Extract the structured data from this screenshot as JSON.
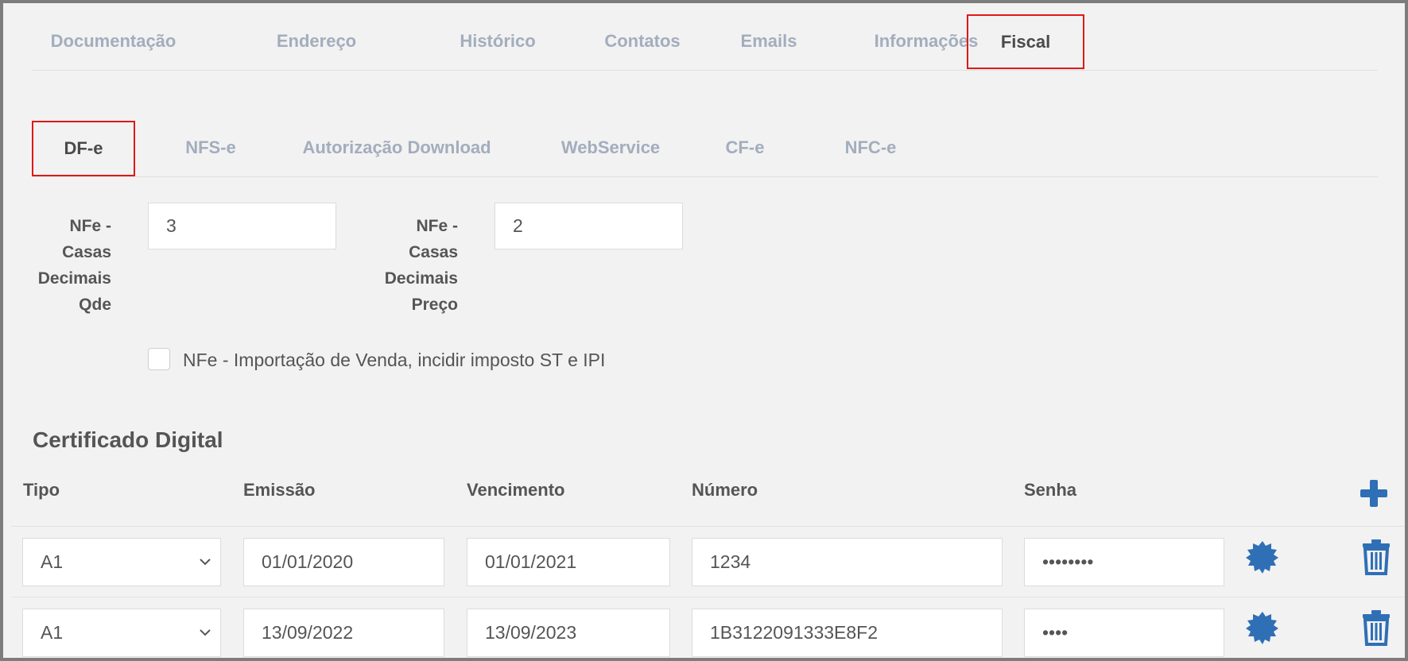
{
  "tabs": [
    {
      "label": "Documentação"
    },
    {
      "label": "Endereço"
    },
    {
      "label": "Histórico"
    },
    {
      "label": "Contatos"
    },
    {
      "label": "Emails"
    },
    {
      "label": "Informações"
    },
    {
      "label": "Fiscal"
    }
  ],
  "active_tab": "Fiscal",
  "subtabs": [
    {
      "label": "DF-e"
    },
    {
      "label": "NFS-e"
    },
    {
      "label": "Autorização Download"
    },
    {
      "label": "WebService"
    },
    {
      "label": "CF-e"
    },
    {
      "label": "NFC-e"
    }
  ],
  "active_subtab": "DF-e",
  "fields": {
    "qty_decimals": {
      "label_lines": [
        "NFe -",
        "Casas",
        "Decimais",
        "Qde"
      ],
      "value": "3"
    },
    "price_decimals": {
      "label_lines": [
        "NFe -",
        "Casas",
        "Decimais",
        "Preço"
      ],
      "value": "2"
    }
  },
  "checkbox": {
    "label": "NFe - Importação de Venda, incidir imposto ST e IPI",
    "checked": false
  },
  "certificate": {
    "title": "Certificado Digital",
    "columns": [
      "Tipo",
      "Emissão",
      "Vencimento",
      "Número",
      "Senha"
    ],
    "rows": [
      {
        "tipo": "A1",
        "emissao": "01/01/2020",
        "vencimento": "01/01/2021",
        "numero": "1234",
        "senha": "••••••••"
      },
      {
        "tipo": "A1",
        "emissao": "13/09/2022",
        "vencimento": "13/09/2023",
        "numero": "1B3122091333E8F2",
        "senha": "••••"
      }
    ]
  },
  "colors": {
    "accent": "#2f6fb5",
    "highlight": "#e01818",
    "inactive_tab": "#a3adbd"
  },
  "icons": {
    "add": "plus-icon",
    "certificate": "badge-icon",
    "delete": "trash-icon",
    "select": "chevron-down-icon"
  }
}
